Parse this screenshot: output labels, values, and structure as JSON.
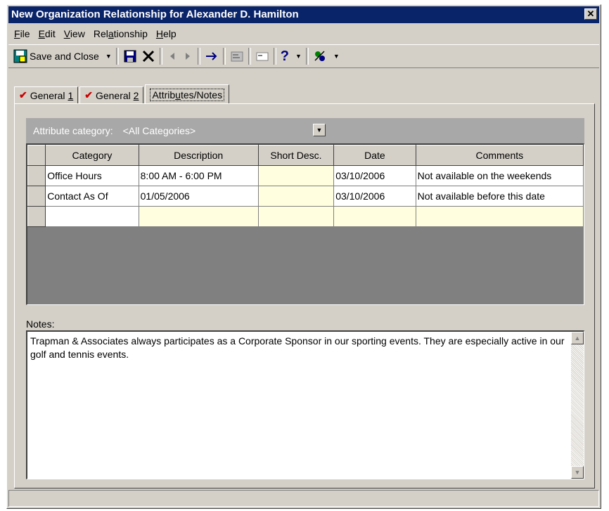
{
  "window": {
    "title": "New Organization Relationship for Alexander D. Hamilton",
    "close_glyph": "✕"
  },
  "menu": [
    {
      "label": "File",
      "key": "F",
      "rest": "ile"
    },
    {
      "label": "Edit",
      "key": "E",
      "rest": "dit"
    },
    {
      "label": "View",
      "key": "V",
      "rest": "iew"
    },
    {
      "label": "Relationship",
      "pre": "Rel",
      "key": "a",
      "rest": "tionship"
    },
    {
      "label": "Help",
      "key": "H",
      "rest": "elp"
    }
  ],
  "toolbar": {
    "save_close_label": "Save and Close",
    "help_glyph": "?"
  },
  "tabs": [
    {
      "label": "General ",
      "key": "1",
      "checked": true
    },
    {
      "label": "General ",
      "key": "2",
      "checked": true
    },
    {
      "label": "Attributes/Notes",
      "pre": "Attrib",
      "key": "u",
      "rest": "tes/Notes",
      "active": true
    }
  ],
  "attributes": {
    "category_label": "Attribute category:",
    "category_value": "<All Categories>",
    "columns": [
      "Category",
      "Description",
      "Short Desc.",
      "Date",
      "Comments"
    ],
    "rows": [
      [
        "Office Hours",
        "8:00 AM - 6:00 PM",
        "",
        "03/10/2006",
        "Not available on the weekends"
      ],
      [
        "Contact As Of",
        "01/05/2006",
        "",
        "03/10/2006",
        "Not available before this date"
      ]
    ]
  },
  "notes": {
    "label": "Notes:",
    "text": "Trapman & Associates always participates as a Corporate Sponsor in our sporting events.  They are especially active in our golf and tennis events."
  },
  "colors": {
    "title_bg": "#0a246a",
    "window_bg": "#d4d0c8",
    "cell_highlight": "#ffffe0",
    "tab_check": "#cc0000"
  }
}
